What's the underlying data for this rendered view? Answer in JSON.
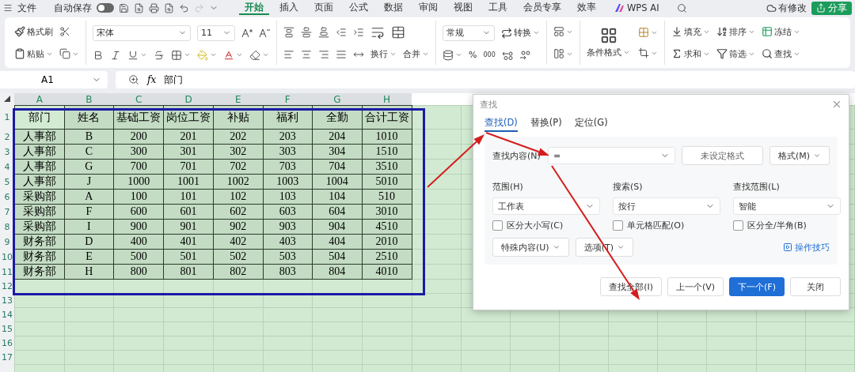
{
  "menu_bar": {
    "file": "文件",
    "autosave": {
      "label": "自动保存",
      "on": false
    },
    "tabs": [
      {
        "label": "开始",
        "selected": true
      },
      {
        "label": "插入",
        "selected": false
      },
      {
        "label": "页面",
        "selected": false
      },
      {
        "label": "公式",
        "selected": false
      },
      {
        "label": "数据",
        "selected": false
      },
      {
        "label": "审阅",
        "selected": false
      },
      {
        "label": "视图",
        "selected": false
      },
      {
        "label": "工具",
        "selected": false
      },
      {
        "label": "会员专享",
        "selected": false
      },
      {
        "label": "效率",
        "selected": false
      }
    ],
    "ai": "WPS AI",
    "status": "有修改",
    "share": "分享"
  },
  "ribbon": {
    "format_painter": "格式刷",
    "paste": "粘贴",
    "font": "宋体",
    "font_size": "11",
    "wrap": "换行",
    "merge": "合并",
    "number_format": "常规",
    "convert": "转换",
    "percent": "%",
    "thousands": "000",
    "conditional": "条件格式",
    "fill": "填充",
    "sort": "排序",
    "freeze": "冻结",
    "sum": "求和",
    "filter": "筛选",
    "find": "查找"
  },
  "formula_bar": {
    "cell": "A1",
    "function_label": "fx",
    "formula": "部门"
  },
  "sheet": {
    "columns": [
      "A",
      "B",
      "C",
      "D",
      "E",
      "F",
      "G",
      "H"
    ],
    "row_numbers": [
      "1",
      "2",
      "3",
      "4",
      "5",
      "6",
      "7",
      "8",
      "9",
      "10",
      "11",
      "12",
      "13",
      "14",
      "15",
      "16",
      "17"
    ],
    "header": [
      "部门",
      "姓名",
      "基础工资",
      "岗位工资",
      "补贴",
      "福利",
      "全勤",
      "合计工资"
    ],
    "rows": [
      [
        "人事部",
        "B",
        "200",
        "201",
        "202",
        "203",
        "204",
        "1010"
      ],
      [
        "人事部",
        "C",
        "300",
        "301",
        "302",
        "303",
        "304",
        "1510"
      ],
      [
        "人事部",
        "G",
        "700",
        "701",
        "702",
        "703",
        "704",
        "3510"
      ],
      [
        "人事部",
        "J",
        "1000",
        "1001",
        "1002",
        "1003",
        "1004",
        "5010"
      ],
      [
        "采购部",
        "A",
        "100",
        "101",
        "102",
        "103",
        "104",
        "510"
      ],
      [
        "采购部",
        "F",
        "600",
        "601",
        "602",
        "603",
        "604",
        "3010"
      ],
      [
        "采购部",
        "I",
        "900",
        "901",
        "902",
        "903",
        "904",
        "4510"
      ],
      [
        "财务部",
        "D",
        "400",
        "401",
        "402",
        "403",
        "404",
        "2010"
      ],
      [
        "财务部",
        "E",
        "500",
        "501",
        "502",
        "503",
        "504",
        "2510"
      ],
      [
        "财务部",
        "H",
        "800",
        "801",
        "802",
        "803",
        "804",
        "4010"
      ]
    ]
  },
  "find_dialog": {
    "title": "查找",
    "tabs": [
      {
        "label": "查找(D)",
        "selected": true
      },
      {
        "label": "替换(P)",
        "selected": false
      },
      {
        "label": "定位(G)",
        "selected": false
      }
    ],
    "find_label": "查找内容(N)",
    "find_value": "=",
    "format_status": "未设定格式",
    "format_button": "格式(M)",
    "selects": [
      {
        "label": "范围(H)",
        "value": "工作表"
      },
      {
        "label": "搜索(S)",
        "value": "按行"
      },
      {
        "label": "查找范围(L)",
        "value": "智能"
      }
    ],
    "checkboxes": [
      {
        "label": "区分大小写(C)",
        "checked": false
      },
      {
        "label": "单元格匹配(O)",
        "checked": false
      },
      {
        "label": "区分全/半角(B)",
        "checked": false
      }
    ],
    "option_buttons": [
      "特殊内容(U)",
      "选项(T)"
    ],
    "tips": "操作技巧",
    "buttons": [
      {
        "label": "查找全部(I)",
        "kind": "normal"
      },
      {
        "label": "上一个(V)",
        "kind": "normal"
      },
      {
        "label": "下一个(F)",
        "kind": "primary"
      },
      {
        "label": "关闭",
        "kind": "normal"
      }
    ]
  }
}
